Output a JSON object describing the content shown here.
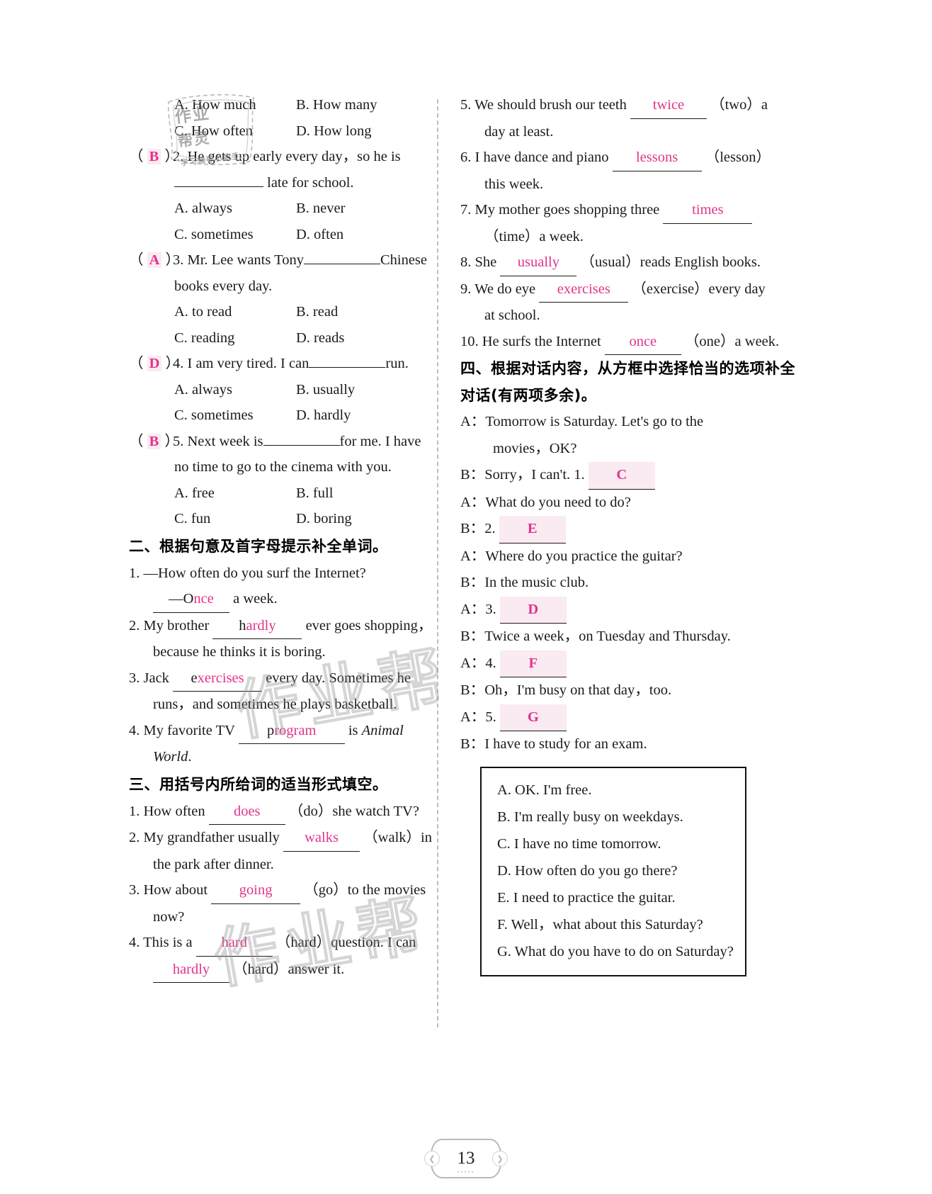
{
  "page": {
    "number": "13",
    "footer_dots": "•••••"
  },
  "watermark": {
    "mark_1": "作业帮",
    "mark_2": "作业帮",
    "stamp_line1": "作业",
    "stamp_line2": "帮灵",
    "stamp_line3": "学习辅导小能手"
  },
  "section_one": {
    "q1_options": [
      {
        "left": "A. How much",
        "right": "B. How many"
      },
      {
        "left": "C. How often",
        "right": "D. How long"
      }
    ],
    "questions": [
      {
        "answer": "B",
        "number": "2.",
        "stem_line1": "He gets up early every day，so he is",
        "stem_line2_blank": "",
        "stem_line2_tail": "late for school.",
        "options": [
          {
            "left": "A. always",
            "right": "B. never"
          },
          {
            "left": "C. sometimes",
            "right": "D. often"
          }
        ]
      },
      {
        "answer": "A",
        "number": "3.",
        "stem_pre": "Mr. Lee wants Tony",
        "stem_post": "Chinese",
        "stem_line2": "books every day.",
        "options": [
          {
            "left": "A. to read",
            "right": "B. read"
          },
          {
            "left": "C. reading",
            "right": "D. reads"
          }
        ]
      },
      {
        "answer": "D",
        "number": "4.",
        "stem_pre": "I am very tired. I can",
        "stem_post": "run.",
        "options": [
          {
            "left": "A. always",
            "right": "B. usually"
          },
          {
            "left": "C. sometimes",
            "right": "D. hardly"
          }
        ]
      },
      {
        "answer": "B",
        "number": "5.",
        "stem_pre": "Next week is",
        "stem_post": "for me. I have",
        "stem_line2": "no time to go to the cinema with you.",
        "options": [
          {
            "left": "A. free",
            "right": "B. full"
          },
          {
            "left": "C. fun",
            "right": "D. boring"
          }
        ]
      }
    ]
  },
  "section_two": {
    "heading": "二、根据句意及首字母提示补全单词。",
    "items": [
      {
        "number": "1.",
        "line1": "—How often do you surf the Internet?",
        "line2_pre": "—O",
        "line2_fill": "nce",
        "line2_post": "a week."
      },
      {
        "number": "2.",
        "line1_pre": "My brother",
        "line1_seed": "h",
        "line1_fill": "ardly",
        "line1_post": "ever goes shopping，",
        "line2": "because he thinks it is boring."
      },
      {
        "number": "3.",
        "line1_pre": "Jack",
        "line1_seed": "e",
        "line1_fill": "xercises",
        "line1_post": "every day. Sometimes he",
        "line2": "runs，and sometimes he plays basketball."
      },
      {
        "number": "4.",
        "line1_pre": "My favorite TV",
        "line1_seed": "p",
        "line1_fill": "rogram",
        "line1_post": "is",
        "line1_italic": "Animal",
        "line2_italic": "World",
        "line2_post": "."
      }
    ]
  },
  "section_three": {
    "heading": "三、用括号内所给词的适当形式填空。",
    "items": [
      {
        "number": "1.",
        "pre": "How often",
        "fill": "does",
        "post": "（do）she watch TV?"
      },
      {
        "number": "2.",
        "pre": "My grandfather usually",
        "fill": "walks",
        "post": "（walk）in",
        "line2": "the park after dinner."
      },
      {
        "number": "3.",
        "pre": "How about",
        "fill": "going",
        "post": "（go）to the movies",
        "line2": "now?"
      },
      {
        "number": "4.",
        "pre": "This is a",
        "fill": "hard",
        "post": "（hard）question. I can",
        "line2_fill": "hardly",
        "line2_post": "（hard）answer it."
      },
      {
        "number": "5.",
        "pre": "We should brush our teeth",
        "fill": "twice",
        "post": "（two）a",
        "line2": "day at least."
      },
      {
        "number": "6.",
        "pre": "I have dance and piano",
        "fill": "lessons",
        "post": "（lesson）",
        "line2": "this week."
      },
      {
        "number": "7.",
        "pre": "My mother goes shopping three",
        "fill": "times",
        "post": "",
        "line2": "（time）a week."
      },
      {
        "number": "8.",
        "pre": "She",
        "fill": "usually",
        "post": "（usual）reads English books."
      },
      {
        "number": "9.",
        "pre": "We do eye",
        "fill": "exercises",
        "post": "（exercise）every day",
        "line2": "at school."
      },
      {
        "number": "10.",
        "pre": "He surfs the Internet",
        "fill": "once",
        "post": "（one）a week."
      }
    ]
  },
  "section_four": {
    "heading_line1": "四、根据对话内容，从方框中选择恰当的选项补全",
    "heading_line2": "对话(有两项多余)。",
    "dialogue": [
      {
        "speaker": "A：",
        "text": "Tomorrow is Saturday. Let's go to the",
        "cont": "movies，OK?"
      },
      {
        "speaker": "B：",
        "text": "Sorry，I can't. 1.",
        "answer": "C"
      },
      {
        "speaker": "A：",
        "text": "What do you need to do?"
      },
      {
        "speaker": "B：",
        "text": "2.",
        "answer": "E"
      },
      {
        "speaker": "A：",
        "text": "Where do you practice the guitar?"
      },
      {
        "speaker": "B：",
        "text": "In the music club."
      },
      {
        "speaker": "A：",
        "text": "3.",
        "answer": "D"
      },
      {
        "speaker": "B：",
        "text": "Twice a week，on Tuesday and Thursday."
      },
      {
        "speaker": "A：",
        "text": "4.",
        "answer": "F"
      },
      {
        "speaker": "B：",
        "text": "Oh，I'm busy on that day，too."
      },
      {
        "speaker": "A：",
        "text": "5.",
        "answer": "G"
      },
      {
        "speaker": "B：",
        "text": "I have to study for an exam."
      }
    ],
    "choices": [
      "A. OK. I'm free.",
      "B. I'm really busy on weekdays.",
      "C. I have no time tomorrow.",
      "D. How often do you go there?",
      "E. I need to practice the guitar.",
      "F. Well，what about this Saturday?",
      "G. What do you have to do on Saturday?"
    ]
  }
}
